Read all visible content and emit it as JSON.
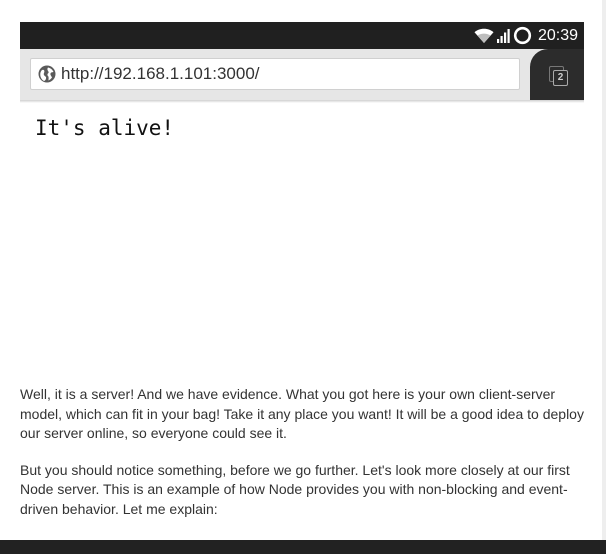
{
  "status_bar": {
    "time": "20:39",
    "icons": [
      "wifi-icon",
      "signal-icon",
      "sync-icon"
    ]
  },
  "browser": {
    "url": "http://192.168.1.101:3000/",
    "tab_count": "2",
    "icons": [
      "globe-icon",
      "tab-switcher-icon"
    ]
  },
  "page": {
    "content": "It's alive!"
  },
  "article": {
    "paragraph_1": "Well, it is a server! And we have evidence. What you got here is your own client-server model, which can fit in your bag! Take it any place you want! It will be a good idea to deploy our server online, so everyone could see it.",
    "paragraph_2": "But you should notice something, before we go further. Let's look more closely at our first Node server. This is an example of how Node provides you with non-blocking and event-driven behavior. Let me explain:"
  },
  "colors": {
    "status_bar": "#202020",
    "toolbar": "#e6e6e6",
    "tab_area": "#2c2c2c",
    "body_text": "#333333",
    "footer": "#222222"
  }
}
